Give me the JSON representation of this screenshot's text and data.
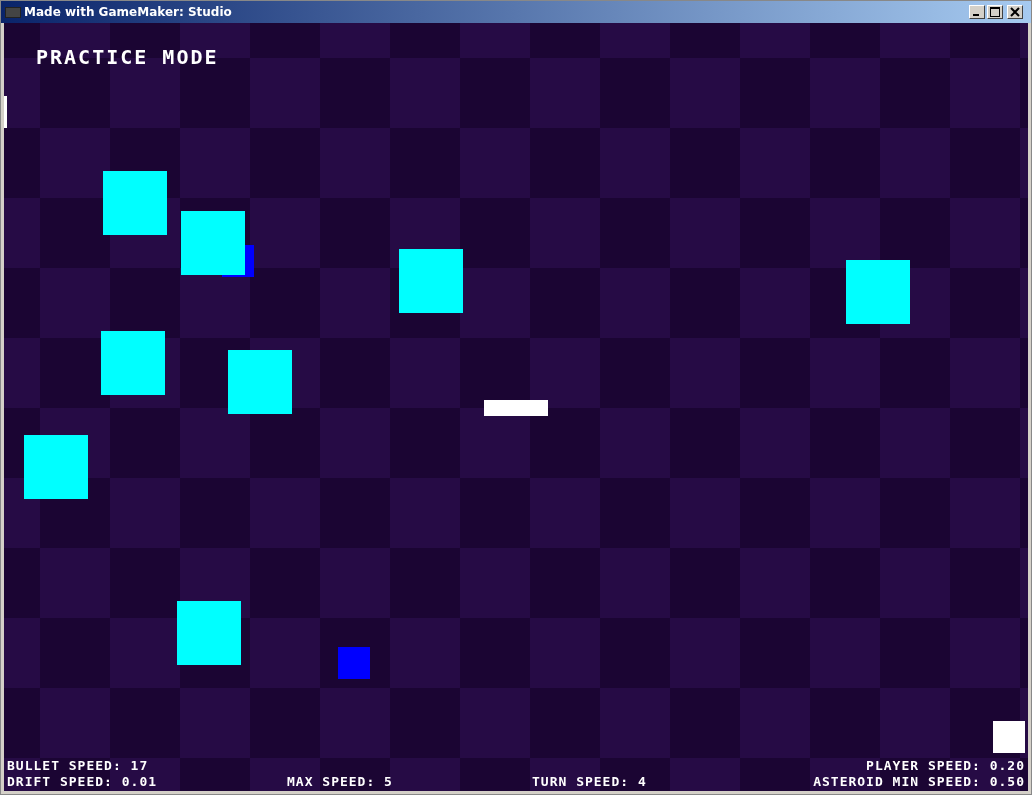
{
  "window": {
    "title": "Made with GameMaker: Studio"
  },
  "hud": {
    "mode": "PRACTICE MODE",
    "stats_top": [
      "BULLET SPEED: 17",
      "PLAYER SPEED: 0.20"
    ],
    "stats_bottom": [
      "DRIFT SPEED: 0.01",
      "MAX SPEED: 5",
      "TURN SPEED: 4",
      "ASTEROID MIN SPEED: 0.50"
    ]
  }
}
